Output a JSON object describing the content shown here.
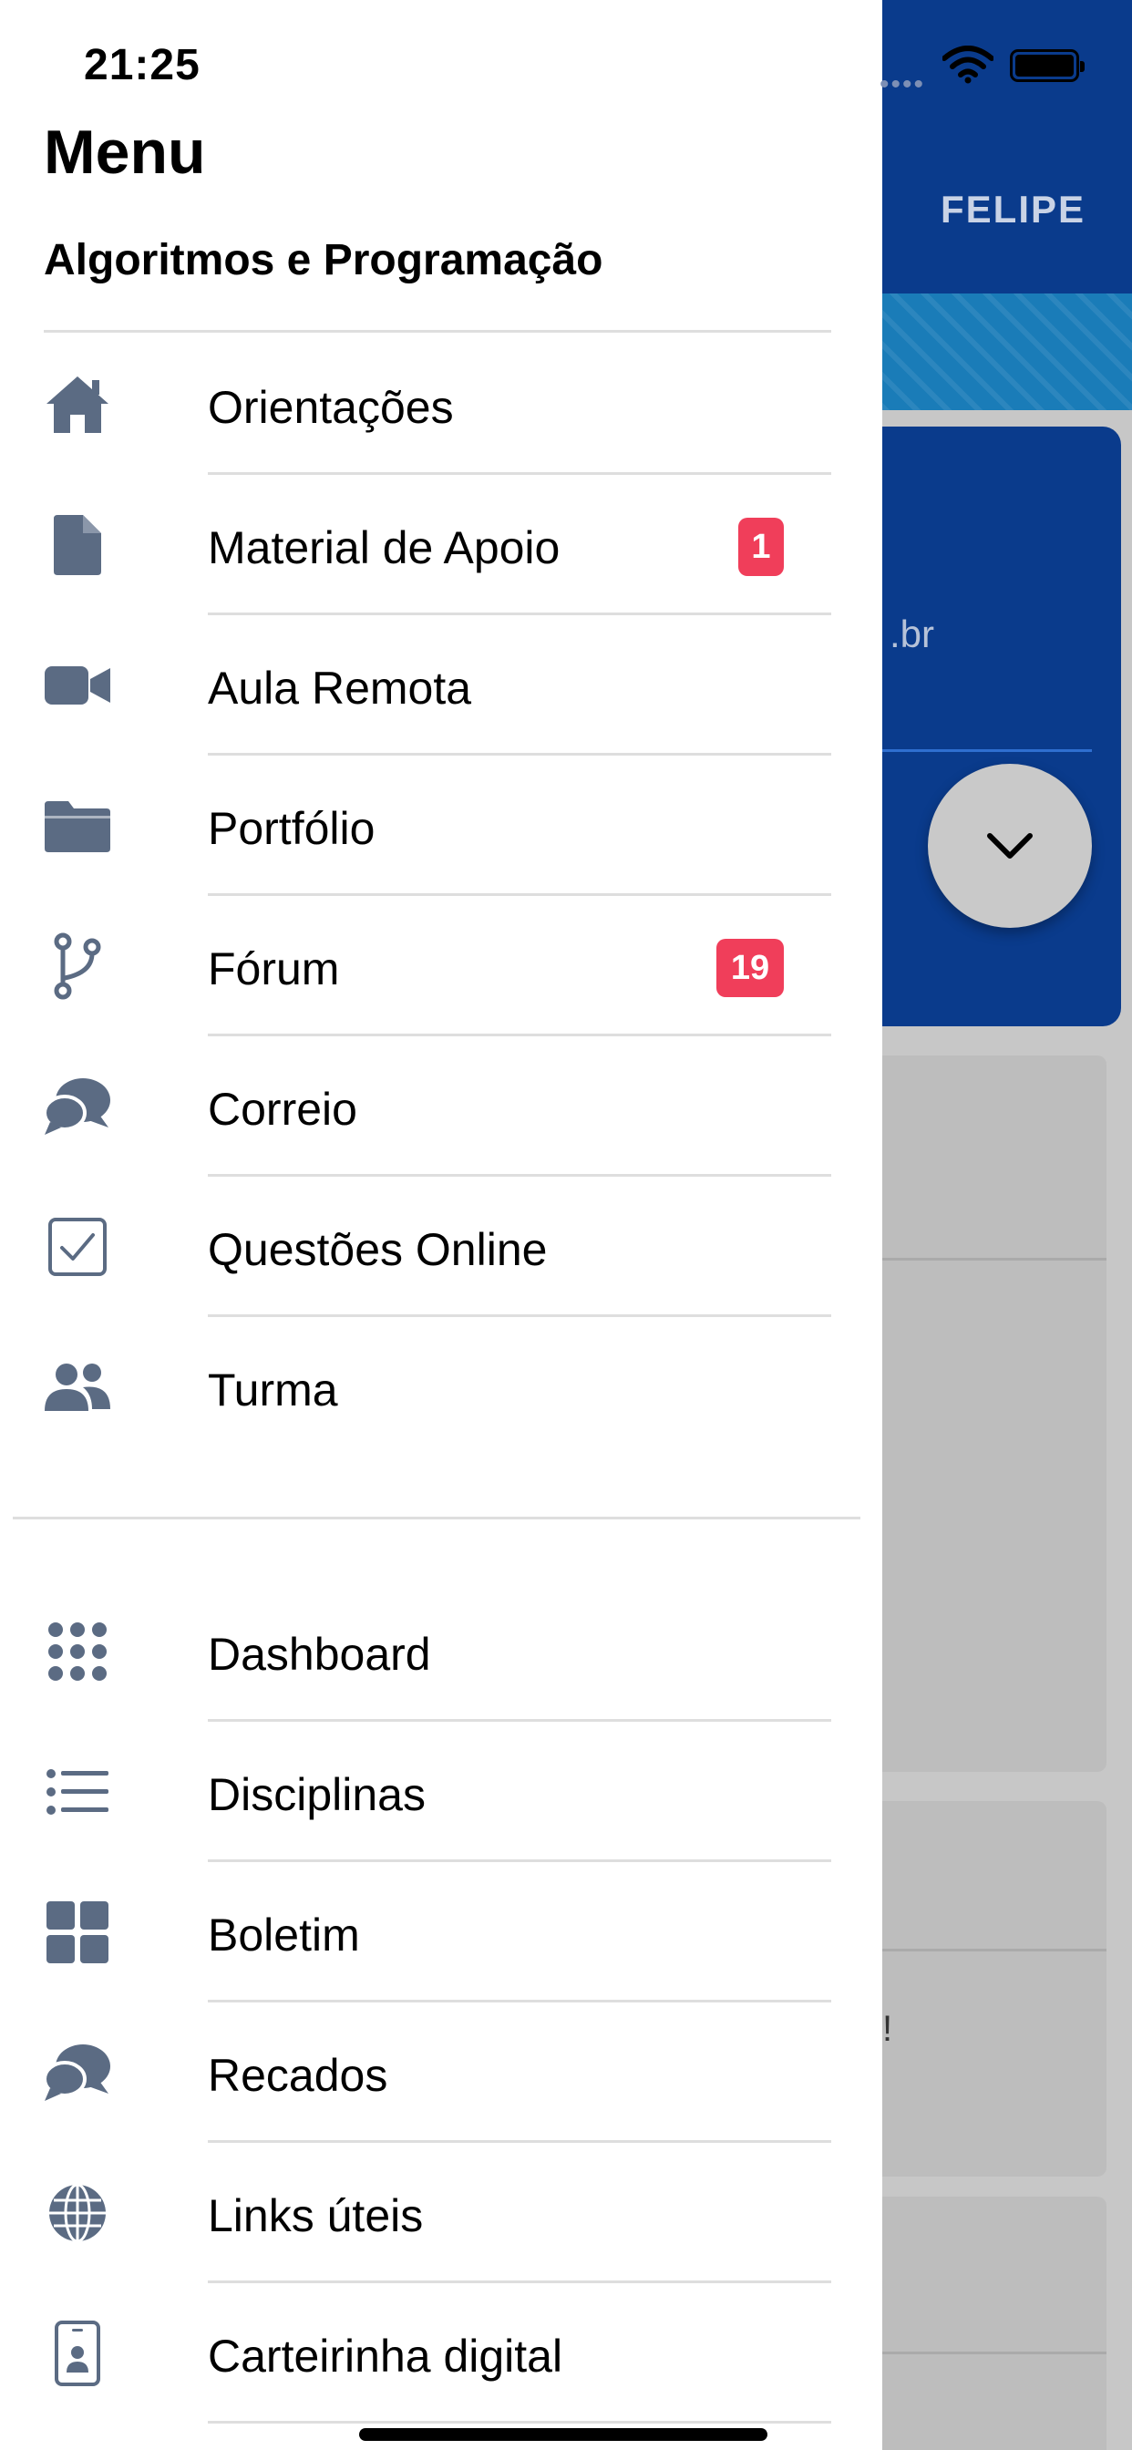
{
  "status_bar": {
    "time": "21:25",
    "signal": "••••"
  },
  "background_app": {
    "user_name": "FELIPE",
    "card_text_fragment": ".br",
    "fragment_exclamation": "!",
    "accent_color": "#0a3b8c"
  },
  "drawer": {
    "title": "Menu",
    "course_name": "Algoritmos e Programação",
    "course_items": [
      {
        "label": "Orientações",
        "icon": "home-icon"
      },
      {
        "label": "Material de Apoio",
        "icon": "document-icon",
        "badge": "1"
      },
      {
        "label": "Aula Remota",
        "icon": "video-camera-icon"
      },
      {
        "label": "Portfólio",
        "icon": "folder-icon"
      },
      {
        "label": "Fórum",
        "icon": "git-branch-icon",
        "badge": "19"
      },
      {
        "label": "Correio",
        "icon": "chat-bubbles-icon"
      },
      {
        "label": "Questões Online",
        "icon": "checkbox-icon"
      },
      {
        "label": "Turma",
        "icon": "users-icon"
      }
    ],
    "general_items": [
      {
        "label": "Dashboard",
        "icon": "grid-dots-icon"
      },
      {
        "label": "Disciplinas",
        "icon": "list-icon"
      },
      {
        "label": "Boletim",
        "icon": "tiles-icon"
      },
      {
        "label": "Recados",
        "icon": "chat-bubbles-icon"
      },
      {
        "label": "Links úteis",
        "icon": "globe-icon"
      },
      {
        "label": "Carteirinha digital",
        "icon": "id-card-icon"
      }
    ],
    "badge_color": "#f03e5a",
    "icon_color": "#5b6b83"
  }
}
